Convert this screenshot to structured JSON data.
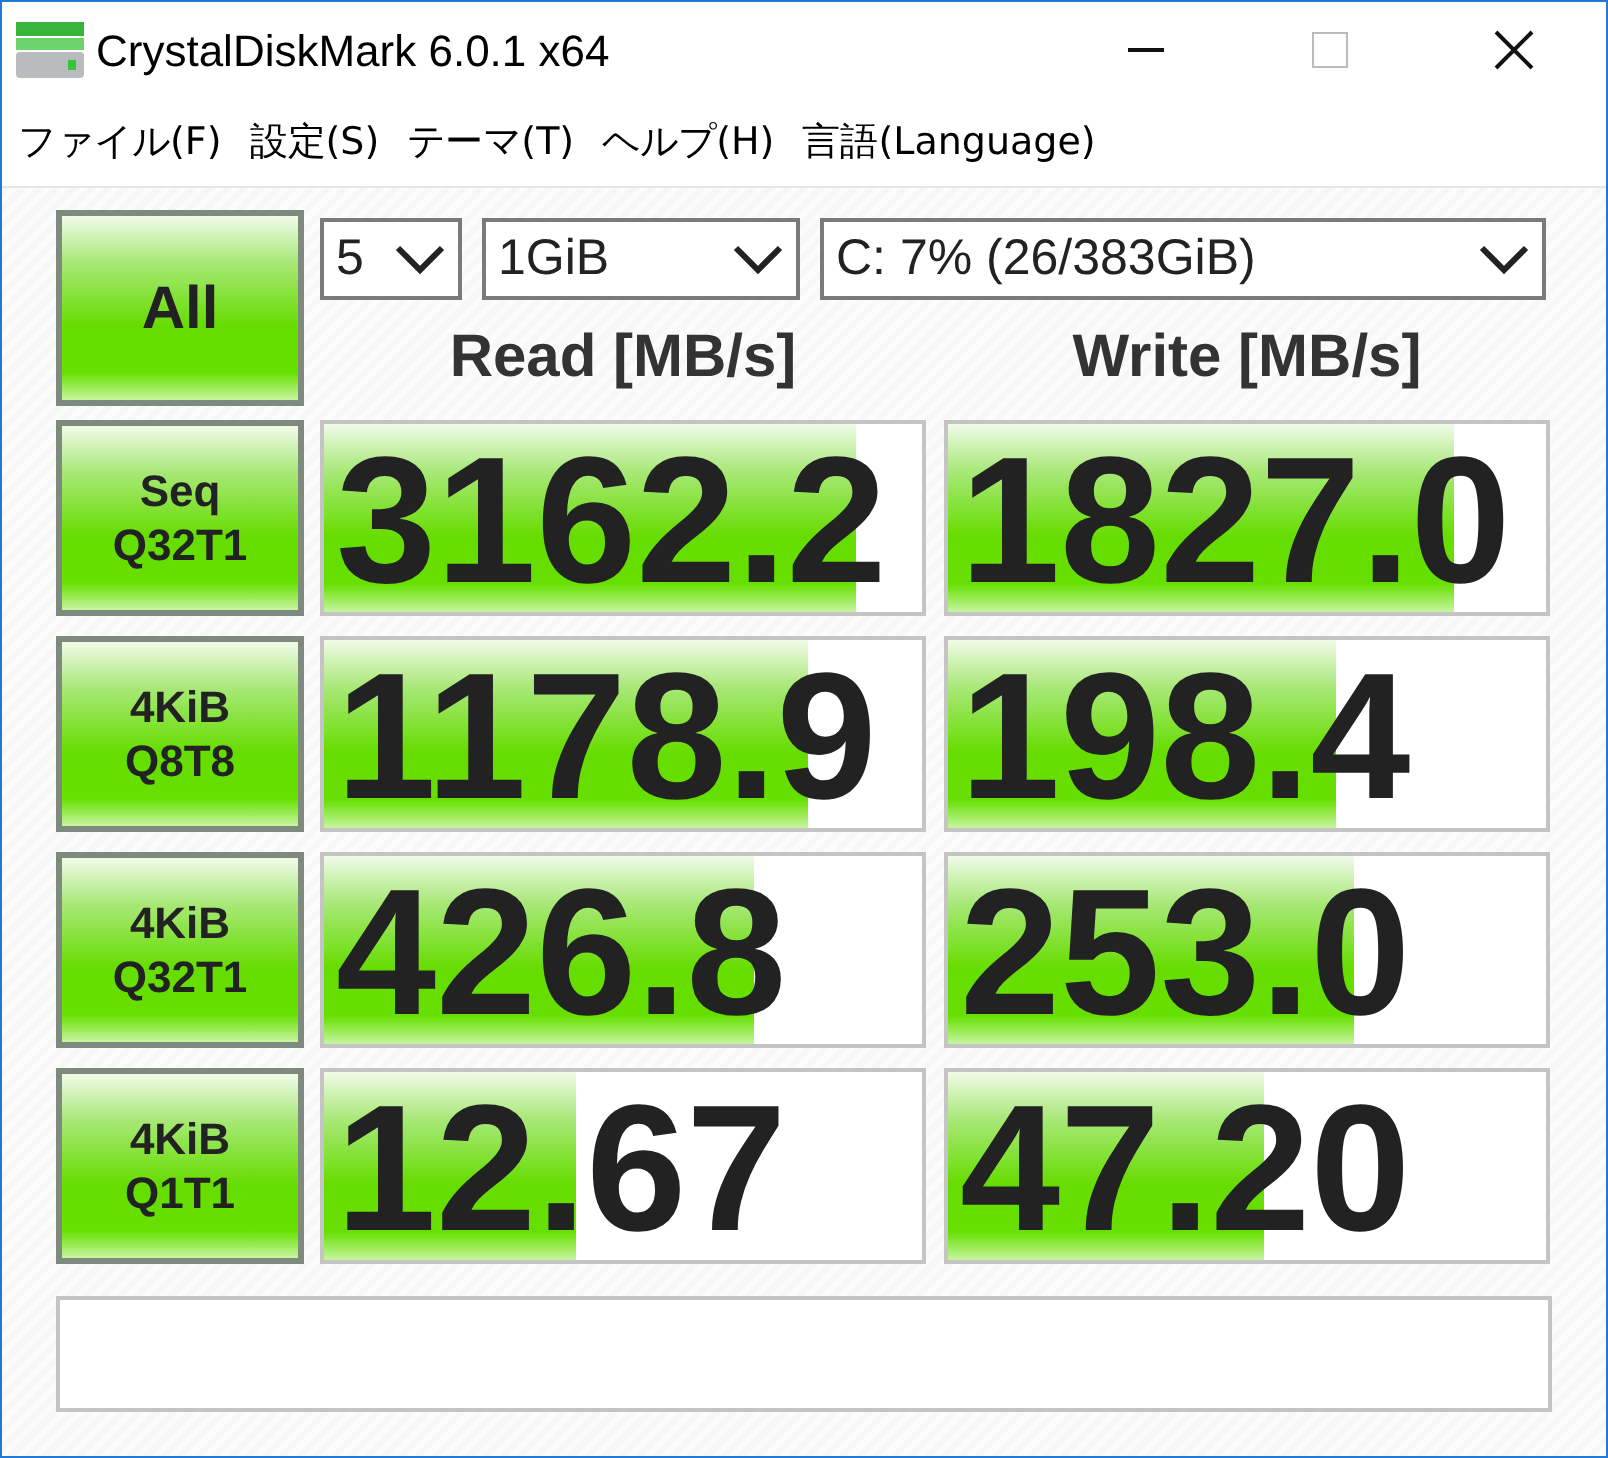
{
  "window": {
    "title": "CrystalDiskMark 6.0.1 x64"
  },
  "menu": [
    "ファイル(F)",
    "設定(S)",
    "テーマ(T)",
    "ヘルプ(H)",
    "言語(Language)"
  ],
  "all_button": "All",
  "selects": [
    {
      "value": "5"
    },
    {
      "value": "1GiB"
    },
    {
      "value": "C: 7% (26/383GiB)"
    }
  ],
  "headers": {
    "read": "Read [MB/s]",
    "write": "Write [MB/s]"
  },
  "tests": [
    {
      "label": "Seq",
      "sub": "Q32T1",
      "read": {
        "value": "3162.2",
        "level": 0.89
      },
      "write": {
        "value": "1827.0",
        "level": 0.845
      }
    },
    {
      "label": "4KiB",
      "sub": "Q8T8",
      "read": {
        "value": "1178.9",
        "level": 0.81
      },
      "write": {
        "value": "198.4",
        "level": 0.65
      }
    },
    {
      "label": "4KiB",
      "sub": "Q32T1",
      "read": {
        "value": "426.8",
        "level": 0.72
      },
      "write": {
        "value": "253.0",
        "level": 0.68
      }
    },
    {
      "label": "4KiB",
      "sub": "Q1T1",
      "read": {
        "value": "12.67",
        "level": 0.42
      },
      "write": {
        "value": "47.20",
        "level": 0.53
      }
    }
  ]
}
